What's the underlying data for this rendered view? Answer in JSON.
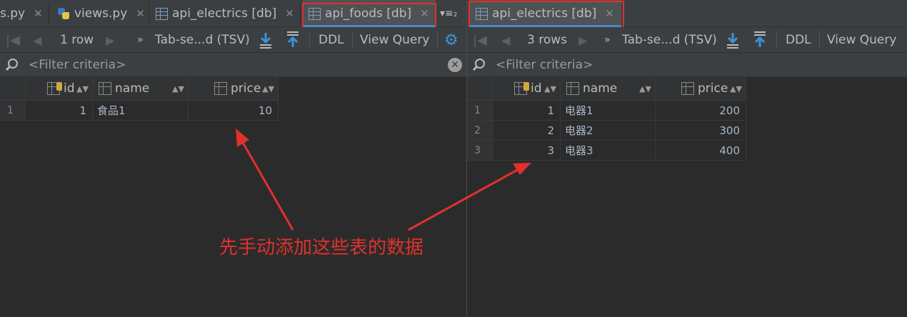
{
  "left": {
    "tabs": [
      {
        "label": "s.py",
        "icon": "python-file-icon"
      },
      {
        "label": "views.py",
        "icon": "python-file-icon"
      },
      {
        "label": "api_electrics [db]",
        "icon": "table-icon"
      },
      {
        "label": "api_foods [db]",
        "icon": "table-icon",
        "active": true
      }
    ],
    "overflow_label": "▾≡₂",
    "toolbar": {
      "rows": "1 row",
      "format": "Tab-se...d (TSV)",
      "ddl": "DDL",
      "view_query": "View Query"
    },
    "filter_placeholder": "<Filter criteria>",
    "columns": [
      "id",
      "name",
      "price"
    ],
    "rows": [
      {
        "num": "1",
        "id": "1",
        "name": "食品1",
        "price": "10"
      }
    ]
  },
  "right": {
    "tabs": [
      {
        "label": "api_electrics [db]",
        "icon": "table-icon",
        "active": true
      }
    ],
    "toolbar": {
      "rows": "3 rows",
      "format": "Tab-se...d (TSV)",
      "ddl": "DDL",
      "view_query": "View Query"
    },
    "filter_placeholder": "<Filter criteria>",
    "columns": [
      "id",
      "name",
      "price"
    ],
    "rows": [
      {
        "num": "1",
        "id": "1",
        "name": "电器1",
        "price": "200"
      },
      {
        "num": "2",
        "id": "2",
        "name": "电器2",
        "price": "300"
      },
      {
        "num": "3",
        "id": "3",
        "name": "电器3",
        "price": "400"
      }
    ]
  },
  "annotation": "先手动添加这些表的数据",
  "colors": {
    "highlight": "#e0312e",
    "accent": "#4a88c7"
  }
}
